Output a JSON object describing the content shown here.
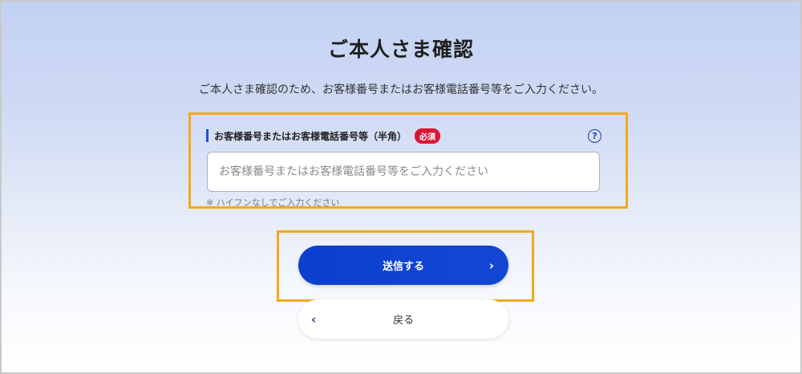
{
  "page": {
    "title": "ご本人さま確認",
    "lead": "ご本人さま確認のため、お客様番号またはお客様電話番号等をご入力ください。"
  },
  "field": {
    "label": "お客様番号またはお客様電話番号等（半角）",
    "required_badge": "必須",
    "help_icon": "question-circle-icon",
    "help_glyph": "?",
    "placeholder": "お客様番号またはお客様電話番号等をご入力ください",
    "value": "",
    "hint": "※ ハイフンなしでご入力ください"
  },
  "actions": {
    "submit_label": "送信する",
    "submit_icon": "chevron-right-icon",
    "submit_glyph": "›",
    "back_label": "戻る",
    "back_icon": "chevron-left-icon",
    "back_glyph": "‹"
  },
  "colors": {
    "primary": "#1347d3",
    "required": "#d91537",
    "highlight": "#f2a91e"
  }
}
